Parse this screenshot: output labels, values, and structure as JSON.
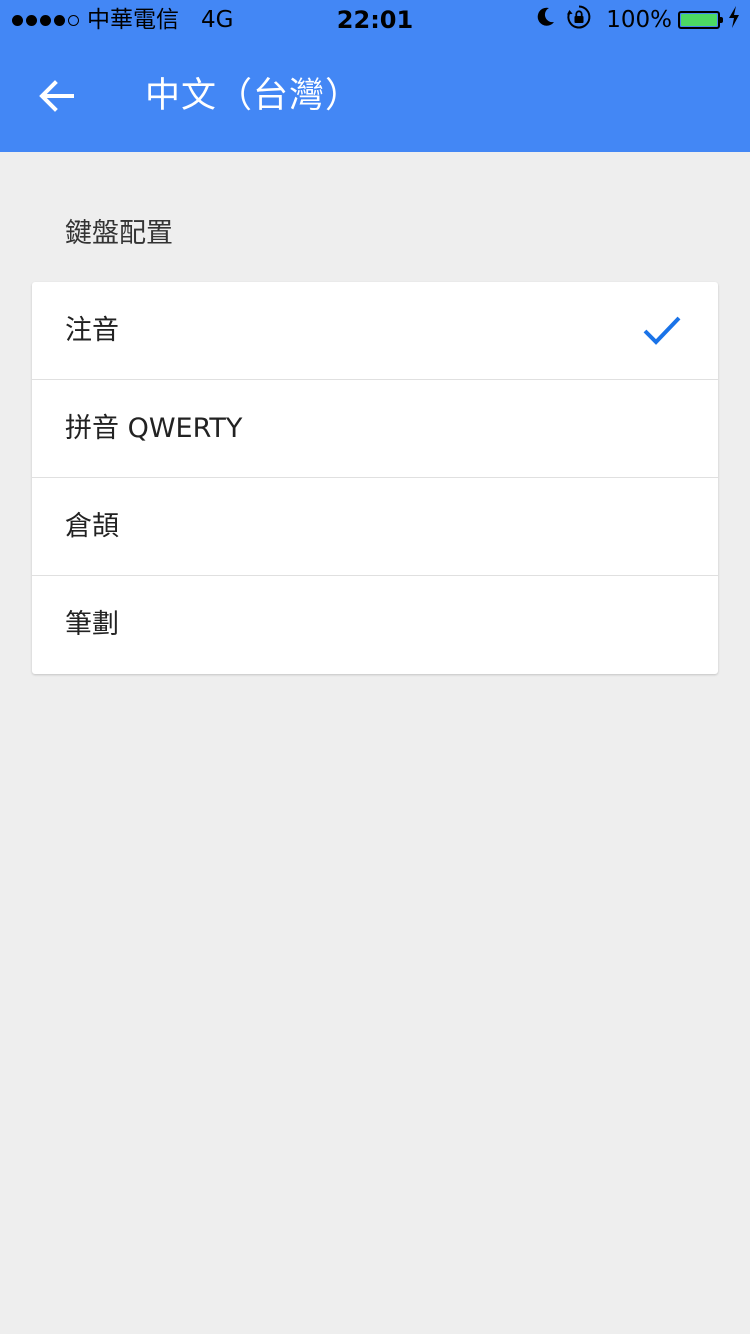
{
  "status_bar": {
    "signal_dots": [
      true,
      true,
      true,
      true,
      false
    ],
    "carrier": "中華電信",
    "network": "4G",
    "time": "22:01",
    "battery_percent": "100%",
    "icons": [
      "moon-icon",
      "rotation-lock-icon",
      "battery-icon",
      "charging-bolt-icon"
    ],
    "battery_fill": 1.0
  },
  "app_bar": {
    "title": "中文（台灣）",
    "back_icon": "arrow-left-icon",
    "color": "#4387f5"
  },
  "section": {
    "header": "鍵盤配置"
  },
  "layouts": [
    {
      "label": "注音",
      "selected": true
    },
    {
      "label": "拼音 QWERTY",
      "selected": false
    },
    {
      "label": "倉頡",
      "selected": false
    },
    {
      "label": "筆劃",
      "selected": false
    }
  ],
  "colors": {
    "accent": "#4387f5",
    "check": "#1a73e8",
    "background": "#eeeeee"
  }
}
